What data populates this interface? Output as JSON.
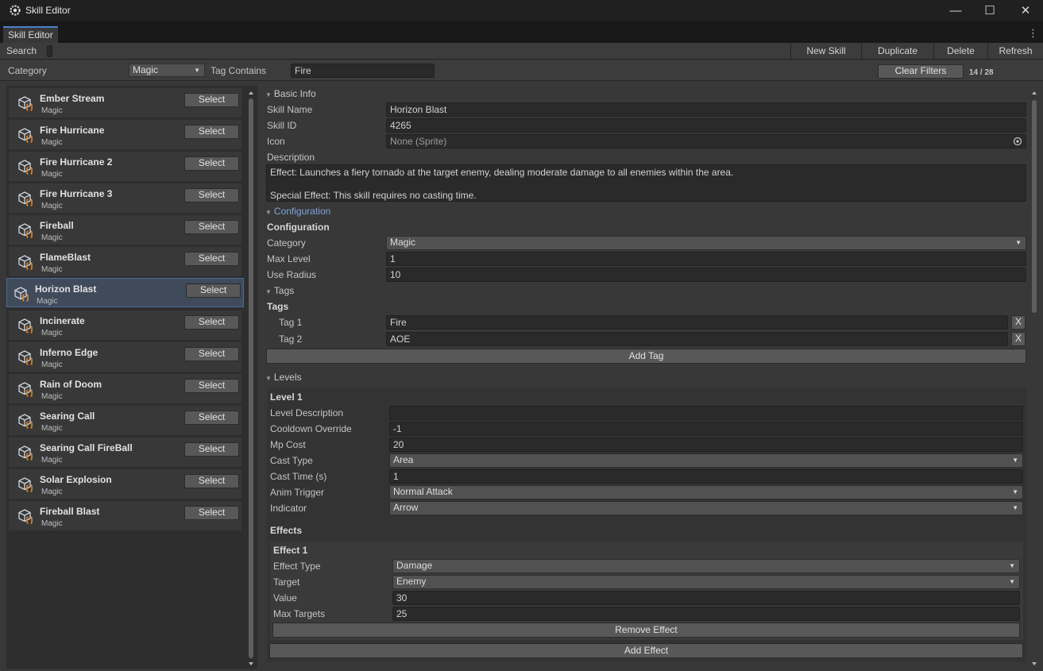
{
  "window": {
    "title": "Skill Editor",
    "minimize": "—",
    "maximize": "☐",
    "close": "✕"
  },
  "tab": {
    "label": "Skill Editor",
    "menu": "⋮"
  },
  "toolbar": {
    "search_label": "Search",
    "new_skill": "New Skill",
    "duplicate": "Duplicate",
    "delete": "Delete",
    "refresh": "Refresh"
  },
  "filters": {
    "category_label": "Category",
    "category_value": "Magic",
    "tag_label": "Tag Contains",
    "tag_value": "Fire",
    "clear": "Clear Filters",
    "count": "14 / 28"
  },
  "skills": [
    {
      "name": "Ember Stream",
      "category": "Magic",
      "button": "Select"
    },
    {
      "name": "Fire Hurricane",
      "category": "Magic",
      "button": "Select"
    },
    {
      "name": "Fire Hurricane 2",
      "category": "Magic",
      "button": "Select"
    },
    {
      "name": "Fire Hurricane 3",
      "category": "Magic",
      "button": "Select"
    },
    {
      "name": "Fireball",
      "category": "Magic",
      "button": "Select"
    },
    {
      "name": "FlameBlast",
      "category": "Magic",
      "button": "Select"
    },
    {
      "name": "Horizon Blast",
      "category": "Magic",
      "button": "Select"
    },
    {
      "name": "Incinerate",
      "category": "Magic",
      "button": "Select"
    },
    {
      "name": "Inferno Edge",
      "category": "Magic",
      "button": "Select"
    },
    {
      "name": "Rain of Doom",
      "category": "Magic",
      "button": "Select"
    },
    {
      "name": "Searing Call",
      "category": "Magic",
      "button": "Select"
    },
    {
      "name": "Searing Call FireBall",
      "category": "Magic",
      "button": "Select"
    },
    {
      "name": "Solar Explosion",
      "category": "Magic",
      "button": "Select"
    },
    {
      "name": "Fireball Blast",
      "category": "Magic",
      "button": "Select"
    }
  ],
  "selected_skill": "Horizon Blast",
  "basic": {
    "header": "Basic Info",
    "name_label": "Skill Name",
    "name": "Horizon Blast",
    "id_label": "Skill ID",
    "id": "4265",
    "icon_label": "Icon",
    "icon": "None (Sprite)",
    "desc_label": "Description",
    "desc_line1": "Effect: Launches a fiery tornado at the target enemy, dealing moderate damage to all enemies within the area.",
    "desc_line2": "Special Effect: This skill requires no casting time."
  },
  "config": {
    "header": "Configuration",
    "title": "Configuration",
    "category_label": "Category",
    "category": "Magic",
    "max_level_label": "Max Level",
    "max_level": "1",
    "radius_label": "Use Radius",
    "radius": "10"
  },
  "tags": {
    "header": "Tags",
    "title": "Tags",
    "items": [
      {
        "label": "Tag 1",
        "value": "Fire",
        "remove": "X"
      },
      {
        "label": "Tag 2",
        "value": "AOE",
        "remove": "X"
      }
    ],
    "add": "Add Tag"
  },
  "levels": {
    "header": "Levels",
    "level_title": "Level 1",
    "desc_label": "Level Description",
    "desc": "",
    "cooldown_label": "Cooldown Override",
    "cooldown": "-1",
    "mp_label": "Mp Cost",
    "mp": "20",
    "cast_type_label": "Cast Type",
    "cast_type": "Area",
    "cast_time_label": "Cast Time (s)",
    "cast_time": "1",
    "anim_label": "Anim Trigger",
    "anim": "Normal Attack",
    "indicator_label": "Indicator",
    "indicator": "Arrow",
    "effects_title": "Effects",
    "effect": {
      "title": "Effect 1",
      "type_label": "Effect Type",
      "type": "Damage",
      "target_label": "Target",
      "target": "Enemy",
      "value_label": "Value",
      "value": "30",
      "max_label": "Max Targets",
      "max": "25",
      "remove": "Remove Effect"
    },
    "add_effect": "Add Effect"
  }
}
